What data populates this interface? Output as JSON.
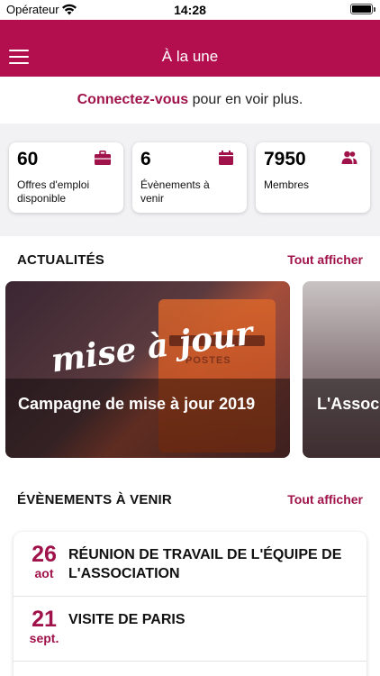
{
  "status_bar": {
    "carrier": "Opérateur",
    "time": "14:28"
  },
  "header": {
    "title": "À la une",
    "menu_icon": "hamburger-menu-icon"
  },
  "connect": {
    "link": "Connectez-vous",
    "rest": " pour en voir plus."
  },
  "stats": [
    {
      "number": "60",
      "label": "Offres d'emploi disponible",
      "icon": "briefcase-icon"
    },
    {
      "number": "6",
      "label": "Évènements à venir",
      "icon": "calendar-icon"
    },
    {
      "number": "7950",
      "label": "Membres",
      "icon": "users-icon"
    }
  ],
  "news": {
    "title": "ACTUALITÉS",
    "link": "Tout afficher",
    "cards": [
      {
        "title": "Campagne de mise à jour 2019",
        "logo_text": "mise à jour",
        "postbox_text": "POSTES"
      },
      {
        "title": "L'Associ"
      }
    ]
  },
  "events": {
    "title": "ÉVÈNEMENTS À VENIR",
    "link": "Tout afficher",
    "items": [
      {
        "day": "26",
        "month": "aot",
        "title": "RÉUNION DE TRAVAIL DE L'ÉQUIPE DE L'ASSOCIATION"
      },
      {
        "day": "21",
        "month": "sept.",
        "title": "VISITE DE PARIS"
      }
    ]
  },
  "colors": {
    "brand": "#b30f4e",
    "accent": "#a0124a"
  }
}
